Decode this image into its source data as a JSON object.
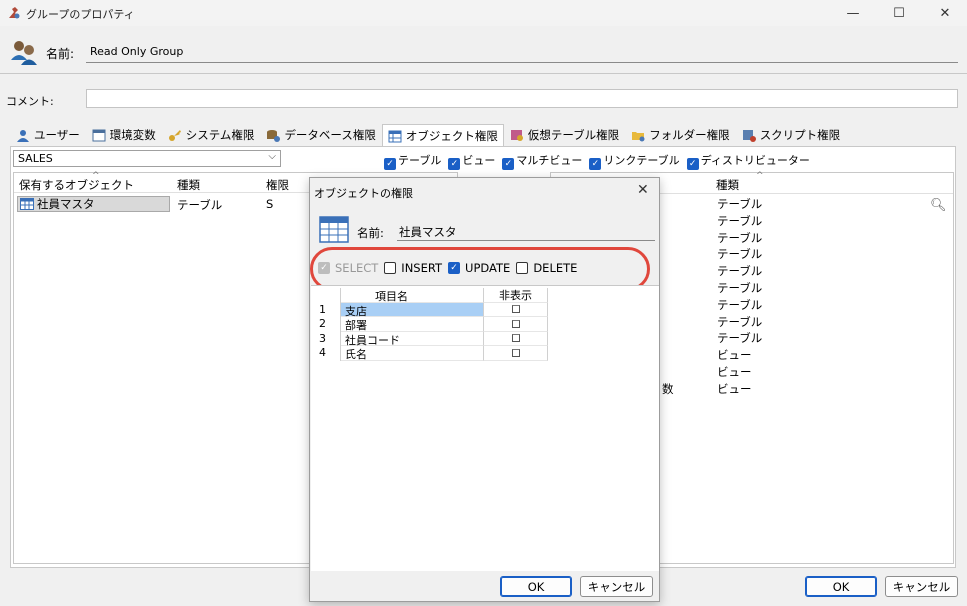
{
  "window": {
    "title": "グループのプロパティ",
    "controls": {
      "minimize": "—",
      "maximize": "☐",
      "close": "✕"
    }
  },
  "header": {
    "name_label": "名前:",
    "name_value": "Read Only Group",
    "comment_label": "コメント:"
  },
  "tabs": [
    {
      "label": "ユーザー",
      "icon": "user-icon"
    },
    {
      "label": "環境変数",
      "icon": "env-var-icon"
    },
    {
      "label": "システム権限",
      "icon": "key-icon"
    },
    {
      "label": "データベース権限",
      "icon": "database-icon"
    },
    {
      "label": "オブジェクト権限",
      "icon": "table-icon",
      "active": true
    },
    {
      "label": "仮想テーブル権限",
      "icon": "virtual-table-icon"
    },
    {
      "label": "フォルダー権限",
      "icon": "folder-icon"
    },
    {
      "label": "スクリプト権限",
      "icon": "script-icon"
    }
  ],
  "database_select": {
    "value": "SALES"
  },
  "filters": [
    {
      "label": "テーブル",
      "checked": true
    },
    {
      "label": "ビュー",
      "checked": true
    },
    {
      "label": "マルチビュー",
      "checked": true
    },
    {
      "label": "リンクテーブル",
      "checked": true
    },
    {
      "label": "ディストリビューター",
      "checked": true
    }
  ],
  "owned_objects": {
    "columns": [
      "保有するオブジェクト",
      "種類",
      "権限"
    ],
    "rows": [
      {
        "name": "社員マスタ",
        "type": "テーブル",
        "perm": "S"
      }
    ]
  },
  "available_objects": {
    "type_header": "種類",
    "partial_text": "数",
    "types": [
      "テーブル",
      "テーブル",
      "テーブル",
      "テーブル",
      "テーブル",
      "テーブル",
      "テーブル",
      "テーブル",
      "テーブル",
      "ビュー",
      "ビュー",
      "ビュー"
    ]
  },
  "main_buttons": {
    "ok": "OK",
    "cancel": "キャンセル"
  },
  "dialog": {
    "title": "オブジェクトの権限",
    "close": "✕",
    "name_label": "名前:",
    "name_value": "社員マスタ",
    "permissions": [
      {
        "label": "SELECT",
        "checked": true,
        "disabled": true
      },
      {
        "label": "INSERT",
        "checked": false
      },
      {
        "label": "UPDATE",
        "checked": true
      },
      {
        "label": "DELETE",
        "checked": false
      }
    ],
    "grid": {
      "columns": [
        "項目名",
        "非表示"
      ],
      "rows": [
        {
          "num": "1",
          "name": "支店"
        },
        {
          "num": "2",
          "name": "部署"
        },
        {
          "num": "3",
          "name": "社員コード"
        },
        {
          "num": "4",
          "name": "氏名"
        }
      ]
    },
    "ok": "OK",
    "cancel": "キャンセル"
  },
  "colors": {
    "accent": "#1a5fc6",
    "highlight": "#e0473c",
    "selection": "#a9cff5"
  }
}
